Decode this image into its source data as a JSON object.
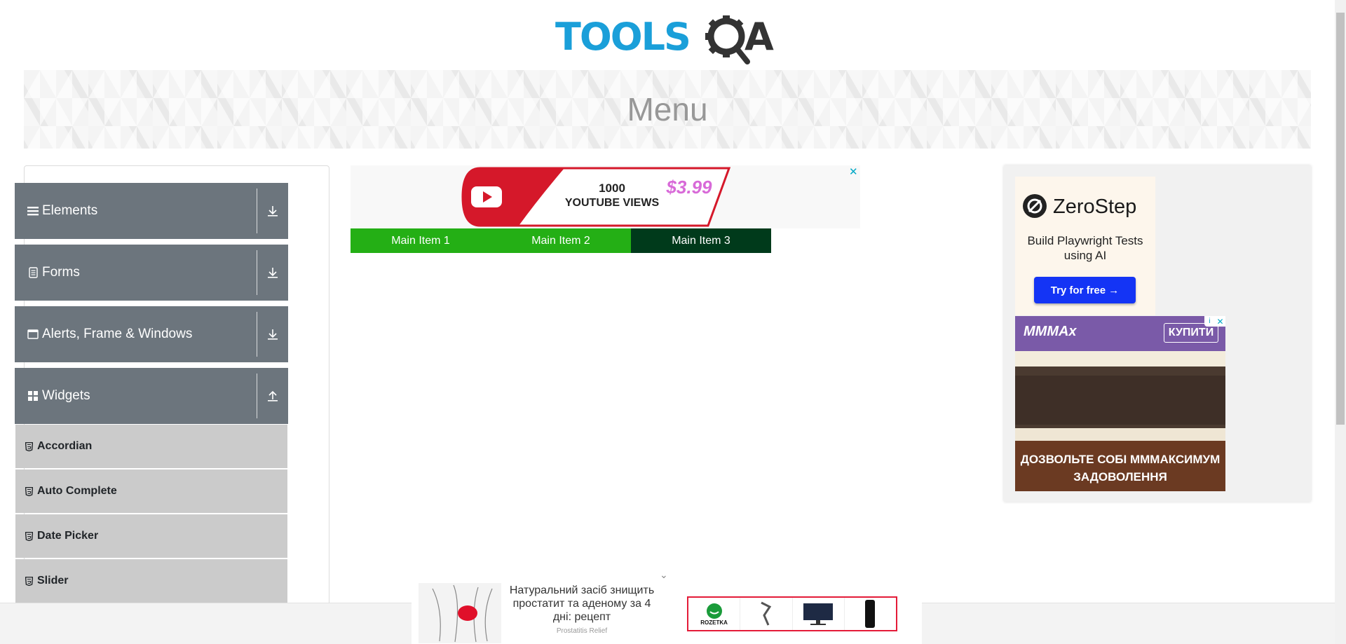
{
  "header": {
    "logo_text": "TOOLSQA",
    "page_title": "Menu"
  },
  "sidebar": {
    "groups": [
      {
        "label": "Elements",
        "icon": "hamburger-icon",
        "arrow": "download-arrow-icon"
      },
      {
        "label": "Forms",
        "icon": "form-icon",
        "arrow": "download-arrow-icon"
      },
      {
        "label": "Alerts, Frame & Windows",
        "icon": "window-icon",
        "arrow": "download-arrow-icon"
      },
      {
        "label": "Widgets",
        "icon": "widgets-icon",
        "arrow": "upload-arrow-icon"
      }
    ],
    "widget_items": [
      {
        "label": "Accordian"
      },
      {
        "label": "Auto Complete"
      },
      {
        "label": "Date Picker"
      },
      {
        "label": "Slider"
      }
    ]
  },
  "top_ad": {
    "line1": "1000",
    "line2": "YOUTUBE VIEWS",
    "price": "$3.99",
    "close": "✕"
  },
  "menu": {
    "items": [
      {
        "label": "Main Item 1"
      },
      {
        "label": "Main Item 2"
      },
      {
        "label": "Main Item 3"
      }
    ]
  },
  "right_ad_zerostep": {
    "brand": "ZeroStep",
    "subtitle": "Build Playwright Tests using AI",
    "button": "Try for free →"
  },
  "right_ad_cake": {
    "brand": "MMMAx",
    "buy": "КУПИТИ",
    "slogan": "ДОЗВОЛЬТЕ СОБІ ММMАКСИМУМ ЗАДОВОЛЕННЯ",
    "close": "✕",
    "info": "i"
  },
  "bottom_ad": {
    "text": "Натуральний засіб знищить простатит та аденому за 4 дні: рецепт",
    "brand": "Prostatitis Relief",
    "store": "ROZETKA",
    "chevron": "⌄"
  },
  "colors": {
    "sidebar_group_bg": "#6c757d",
    "sidebar_item_bg": "#cbcbcb",
    "menu_green": "#24af15",
    "menu_dark": "#003a1b",
    "logo_blue": "#1a9fd9",
    "logo_dark": "#333333",
    "zerostep_button": "#1434f5"
  }
}
